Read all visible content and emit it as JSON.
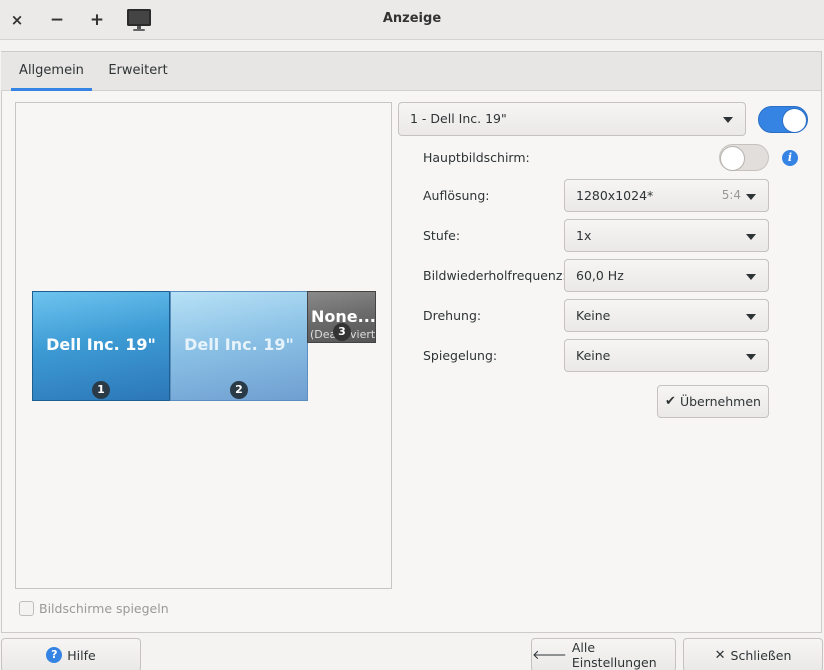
{
  "window": {
    "title": "Anzeige",
    "controls": {
      "close": "×",
      "minimize": "−",
      "maximize": "+"
    }
  },
  "tabs": [
    {
      "label": "Allgemein",
      "active": true
    },
    {
      "label": "Erweitert",
      "active": false
    }
  ],
  "monitors": [
    {
      "label": "Dell Inc. 19\"",
      "number": "1",
      "sublabel": ""
    },
    {
      "label": "Dell Inc. 19\"",
      "number": "2",
      "sublabel": ""
    },
    {
      "label": "None...",
      "number": "3",
      "sublabel": "(Deaktiviert)"
    }
  ],
  "mirror_displays": {
    "label": "Bildschirme spiegeln",
    "checked": false
  },
  "display_select": {
    "value": "1 - Dell Inc. 19\"",
    "enabled": true
  },
  "settings": {
    "primary": {
      "label": "Hauptbildschirm:",
      "on": false,
      "info_icon": "info-icon"
    },
    "resolution": {
      "label": "Auflösung:",
      "value": "1280x1024*",
      "ratio": "5:4"
    },
    "scale": {
      "label": "Stufe:",
      "value": "1x"
    },
    "refresh_rate": {
      "label": "Bildwiederholfrequenz:",
      "value": "60,0 Hz"
    },
    "rotation": {
      "label": "Drehung:",
      "value": "Keine"
    },
    "reflection": {
      "label": "Spiegelung:",
      "value": "Keine"
    }
  },
  "apply_button": {
    "label": "Übernehmen",
    "icon": "checkmark-icon"
  },
  "footer": {
    "help": {
      "label": "Hilfe",
      "icon": "help-icon"
    },
    "all_settings": {
      "label": "Alle Einstellungen",
      "icon": "arrow-left-icon"
    },
    "close": {
      "label": "Schließen",
      "icon": "close-icon"
    }
  },
  "colors": {
    "accent": "#3584e4",
    "monitor_primary": "#3d9bd4",
    "monitor_secondary": "#8cc2e6",
    "monitor_disabled": "#6b6b6b"
  }
}
